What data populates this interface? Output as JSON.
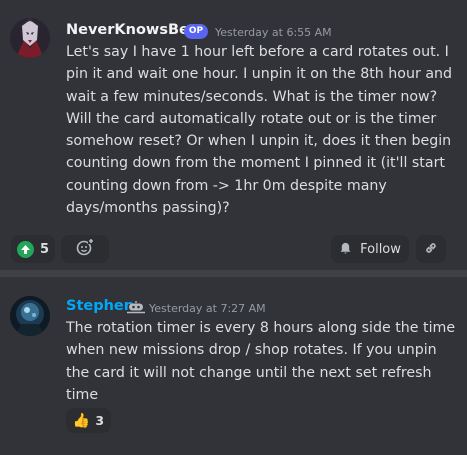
{
  "post": {
    "author": "NeverKnowsBest",
    "op_badge": "OP",
    "timestamp": "Yesterday at 6:55 AM",
    "text": "Let's say I have 1 hour left before a card rotates out. I pin it and wait one hour. I unpin it on the 8th hour and wait a few minutes/seconds. What is the timer now? Will the card automatically rotate out or is the timer somehow reset? Or when I unpin it, does it then begin counting down from the moment I pinned it (it'll start counting down from -> 1hr 0m despite many days/months passing)?",
    "upvote_count": "5",
    "follow_label": "Follow"
  },
  "reply": {
    "author": "Stephen",
    "timestamp": "Yesterday at 7:27 AM",
    "text": "The rotation timer is every 8 hours along side the time when new missions drop / shop rotates.  If you unpin the card it will not change until the next set refresh time",
    "reaction_emoji": "👍",
    "reaction_count": "3"
  },
  "icons": {
    "upvote": "upvote-arrow-icon",
    "add_reaction": "add-reaction-icon",
    "follow": "bell-icon",
    "link": "link-icon",
    "bot": "bot-icon"
  },
  "colors": {
    "background": "#313338",
    "separator": "#3f4147",
    "pill": "#2b2d31",
    "op_badge": "#5865f2",
    "reply_author": "#00a8fc",
    "upvote": "#23a55a"
  }
}
